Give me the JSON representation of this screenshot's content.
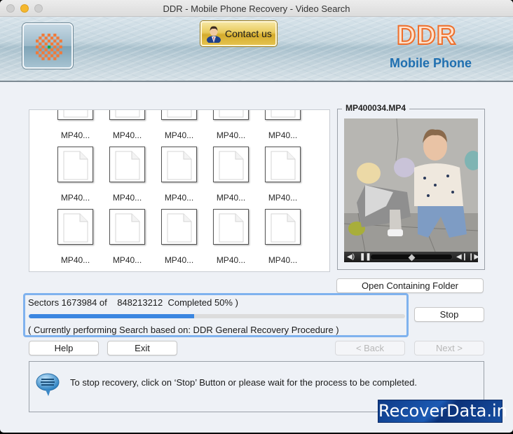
{
  "window": {
    "title": "DDR - Mobile Phone Recovery - Video Search"
  },
  "banner": {
    "contact_label": "Contact us",
    "brand_name": "DDR",
    "brand_subtitle": "Mobile Phone",
    "colors": {
      "brand_orange": "#ee6f2c",
      "brand_blue": "#1f6fb0"
    }
  },
  "files": {
    "rows": [
      [
        "MP40...",
        "MP40...",
        "MP40...",
        "MP40...",
        "MP40..."
      ],
      [
        "MP40...",
        "MP40...",
        "MP40...",
        "MP40...",
        "MP40..."
      ],
      [
        "MP40...",
        "MP40...",
        "MP40...",
        "MP40...",
        "MP40..."
      ]
    ],
    "icon": "blank-document-icon"
  },
  "preview": {
    "filename": "MP400034.MP4",
    "controls": [
      "volume-icon",
      "pause-icon",
      "seek-slider",
      "step-back-icon",
      "step-forward-icon"
    ],
    "seek_position": 0.5
  },
  "buttons": {
    "open_folder": "Open Containing Folder",
    "stop": "Stop",
    "help": "Help",
    "exit": "Exit",
    "back": "< Back",
    "next": "Next >"
  },
  "progress": {
    "line1": "Sectors 1673984 of    848213212  Completed 50% )",
    "fill_fraction": 0.44,
    "line2": "( Currently performing Search based on: DDR General Recovery Procedure )",
    "color": "#3b86e0"
  },
  "message": {
    "text": "To stop recovery, click on ‘Stop’ Button or please wait for the process to be completed."
  },
  "watermark": {
    "text": "RecoverData.in"
  }
}
